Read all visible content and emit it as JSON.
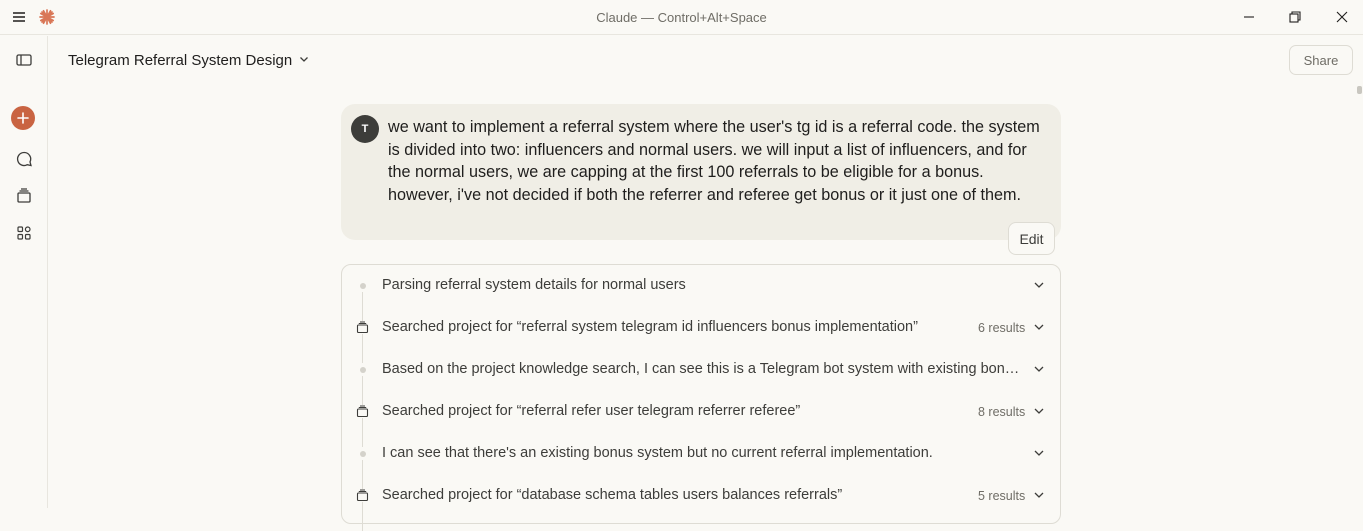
{
  "window": {
    "title": "Claude — Control+Alt+Space",
    "icons": [
      "menu-icon",
      "claude-logo-icon",
      "minimize-icon",
      "maximize-icon",
      "close-icon"
    ]
  },
  "rail": {
    "icons": [
      "sidebar-toggle-icon",
      "new-chat-icon",
      "chats-icon",
      "projects-icon",
      "artifacts-icon"
    ],
    "accent": "#c96442"
  },
  "header": {
    "chat_title": "Telegram Referral System Design",
    "share_label": "Share"
  },
  "message": {
    "avatar_initial": "T",
    "text": "we want to implement a referral system where the user's tg id is a referral code. the system is divided into two: influencers and normal users. we will input a list of influencers, and for the normal users, we are capping at the first 100 referrals to be eligible for a bonus. however, i've not decided if both the referrer and referee get bonus or it just one of them.",
    "edit_label": "Edit"
  },
  "steps": [
    {
      "kind": "thought",
      "label": "Parsing referral system details for normal users",
      "count": ""
    },
    {
      "kind": "search",
      "label": "Searched project for “referral system telegram id influencers bonus implementation”",
      "count": "6 results"
    },
    {
      "kind": "thought",
      "label": "Based on the project knowledge search, I can see this is a Telegram bot system with existing bonus mechanisms and user management",
      "count": ""
    },
    {
      "kind": "search",
      "label": "Searched project for “referral refer user telegram referrer referee”",
      "count": "8 results"
    },
    {
      "kind": "thought",
      "label": "I can see that there's an existing bonus system but no current referral implementation.",
      "count": ""
    },
    {
      "kind": "search",
      "label": "Searched project for “database schema tables users balances referrals”",
      "count": "5 results"
    }
  ]
}
